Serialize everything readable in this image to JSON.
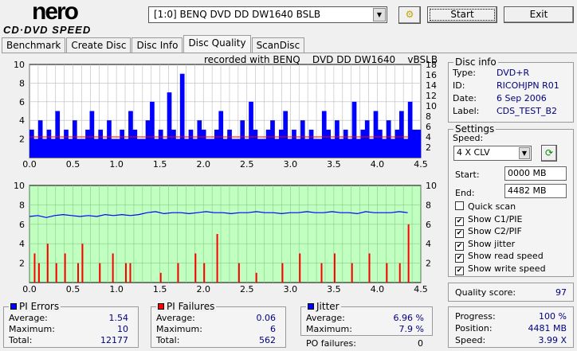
{
  "app": {
    "logo_top": "nero",
    "logo_bottom": "CD·DVD SPEED"
  },
  "toolbar": {
    "drive": "[1:0]  BENQ DVD DD DW1640 BSLB",
    "start": "Start",
    "exit": "Exit"
  },
  "tabs": [
    "Benchmark",
    "Create Disc",
    "Disc Info",
    "Disc Quality",
    "ScanDisc"
  ],
  "active_tab": "Disc Quality",
  "recorded_with": "recorded with BENQ    DVD DD DW1640    vBSLB",
  "disc_info": {
    "title": "Disc info",
    "type_label": "Type:",
    "type": "DVD+R",
    "id_label": "ID:",
    "id": "RICOHJPN R01",
    "date_label": "Date:",
    "date": "6 Sep 2006",
    "label_label": "Label:",
    "label": "CDS_TEST_B2"
  },
  "settings": {
    "title": "Settings",
    "speed_label": "Speed:",
    "speed": "4 X CLV",
    "start_label": "Start:",
    "start": "0000 MB",
    "end_label": "End:",
    "end": "4482 MB",
    "checks": [
      {
        "label": "Quick scan",
        "checked": false
      },
      {
        "label": "Show C1/PIE",
        "checked": true
      },
      {
        "label": "Show C2/PIF",
        "checked": true
      },
      {
        "label": "Show jitter",
        "checked": true
      },
      {
        "label": "Show read speed",
        "checked": true
      },
      {
        "label": "Show write speed",
        "checked": true
      }
    ]
  },
  "quality": {
    "label": "Quality score:",
    "value": "97"
  },
  "progress": {
    "progress_label": "Progress:",
    "progress": "100 %",
    "position_label": "Position:",
    "position": "4481 MB",
    "speed_label": "Speed:",
    "speed": "3.99 X"
  },
  "pi_errors": {
    "title": "PI Errors",
    "avg_label": "Average:",
    "avg": "1.54",
    "max_label": "Maximum:",
    "max": "10",
    "total_label": "Total:",
    "total": "12177",
    "color": "#0000ff"
  },
  "pi_failures": {
    "title": "PI Failures",
    "avg_label": "Average:",
    "avg": "0.06",
    "max_label": "Maximum:",
    "max": "6",
    "total_label": "Total:",
    "total": "562",
    "color": "#ff0000"
  },
  "jitter": {
    "title": "Jitter",
    "avg_label": "Average:",
    "avg": "6.96 %",
    "max_label": "Maximum:",
    "max": "7.9 %",
    "po_label": "PO failures:",
    "po": "0",
    "color": "#0000ff"
  },
  "chart_data": [
    {
      "type": "bar",
      "name": "PI errors",
      "xlim": [
        0,
        4.5
      ],
      "ylim": [
        0,
        10
      ],
      "y2lim": [
        0,
        18
      ],
      "x_ticks": [
        "0.0",
        "0.5",
        "1.0",
        "1.5",
        "2.0",
        "2.5",
        "3.0",
        "3.5",
        "4.0",
        "4.5"
      ],
      "y_ticks": [
        "10",
        "8",
        "6",
        "4",
        "2"
      ],
      "y2_ticks": [
        "18",
        "16",
        "14",
        "12",
        "10",
        "8",
        "6",
        "4",
        "2"
      ],
      "values": [
        3,
        2,
        4,
        2,
        3,
        2,
        5,
        2,
        3,
        2,
        4,
        2,
        2,
        3,
        5,
        2,
        3,
        2,
        4,
        2,
        2,
        3,
        2,
        5,
        3,
        2,
        2,
        4,
        6,
        2,
        3,
        2,
        7,
        3,
        2,
        9,
        2,
        3,
        2,
        4,
        3,
        2,
        2,
        3,
        5,
        2,
        3,
        2,
        2,
        4,
        2,
        6,
        3,
        2,
        2,
        3,
        4,
        2,
        3,
        5,
        2,
        3,
        2,
        4,
        2,
        3,
        2,
        2,
        5,
        3,
        2,
        4,
        2,
        3,
        2,
        6,
        2,
        3,
        4,
        2,
        5,
        3,
        2,
        4,
        2,
        3,
        5,
        2,
        6,
        3,
        3
      ],
      "read_speed": 4
    },
    {
      "type": "bar",
      "name": "PI failures / jitter",
      "xlim": [
        0,
        4.5
      ],
      "ylim": [
        0,
        10
      ],
      "y2lim": [
        0,
        10
      ],
      "x_ticks": [
        "0.0",
        "0.5",
        "1.0",
        "1.5",
        "2.0",
        "2.5",
        "3.0",
        "3.5",
        "4.0",
        "4.5"
      ],
      "y_ticks": [
        "10",
        "8",
        "6",
        "4",
        "2"
      ],
      "y2_ticks": [
        "10",
        "8",
        "6",
        "4",
        "2"
      ],
      "failures": [
        [
          0.05,
          3
        ],
        [
          0.1,
          2
        ],
        [
          0.2,
          4
        ],
        [
          0.3,
          2
        ],
        [
          0.4,
          3
        ],
        [
          0.55,
          2
        ],
        [
          0.6,
          4
        ],
        [
          0.8,
          2
        ],
        [
          0.95,
          3
        ],
        [
          1.1,
          2
        ],
        [
          1.15,
          2
        ],
        [
          1.5,
          1
        ],
        [
          1.7,
          2
        ],
        [
          1.9,
          3
        ],
        [
          2.0,
          2
        ],
        [
          2.15,
          5
        ],
        [
          2.4,
          2
        ],
        [
          2.6,
          1
        ],
        [
          2.9,
          2
        ],
        [
          3.1,
          3
        ],
        [
          3.35,
          2
        ],
        [
          3.5,
          3
        ],
        [
          3.7,
          2
        ],
        [
          3.9,
          3
        ],
        [
          4.1,
          2
        ],
        [
          4.25,
          2
        ],
        [
          4.35,
          6
        ]
      ],
      "jitter": [
        6.8,
        6.9,
        6.7,
        6.9,
        7.0,
        6.9,
        6.8,
        6.9,
        6.8,
        7.0,
        6.9,
        7.0,
        6.9,
        7.0,
        7.2,
        7.3,
        7.1,
        7.2,
        7.2,
        7.1,
        7.2,
        7.3,
        7.2,
        7.2,
        7.1,
        7.2,
        7.2,
        7.3,
        7.2,
        7.2,
        7.1,
        7.2,
        7.2,
        7.3,
        7.2,
        7.2,
        7.3,
        7.2,
        7.2,
        7.1,
        7.3,
        7.2,
        7.2,
        7.2,
        7.3,
        7.2
      ]
    }
  ]
}
